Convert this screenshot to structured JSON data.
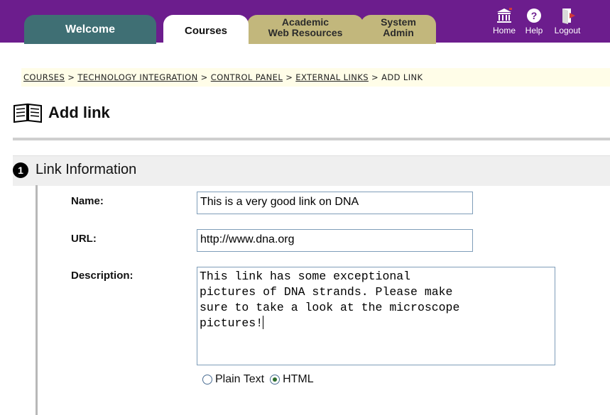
{
  "nav": {
    "tabs": [
      {
        "label": "Welcome"
      },
      {
        "label": "Courses"
      },
      {
        "label": "Academic Web Resources"
      },
      {
        "label": "System Admin"
      }
    ],
    "links": {
      "home": "Home",
      "help": "Help",
      "logout": "Logout"
    },
    "colors": {
      "bar": "#6c1d8d",
      "welcome_tab": "#3f6f74",
      "resource_tabs": "#c2b77c"
    }
  },
  "breadcrumb": {
    "items": [
      "COURSES",
      "TECHNOLOGY INTEGRATION",
      "CONTROL PANEL",
      "EXTERNAL LINKS"
    ],
    "separator": ">",
    "current": "ADD LINK"
  },
  "page": {
    "title": "Add link",
    "icon": "book-icon"
  },
  "section": {
    "number": "1",
    "title": "Link Information"
  },
  "form": {
    "name_label": "Name:",
    "name_value": "This is a very good link on DNA",
    "url_label": "URL:",
    "url_value": "http://www.dna.org",
    "description_label": "Description:",
    "description_value": "This link has some exceptional\npictures of DNA strands. Please make\nsure to take a look at the microscope\npictures!",
    "format_options": [
      {
        "label": "Plain Text",
        "selected": false
      },
      {
        "label": "HTML",
        "selected": true
      }
    ]
  }
}
